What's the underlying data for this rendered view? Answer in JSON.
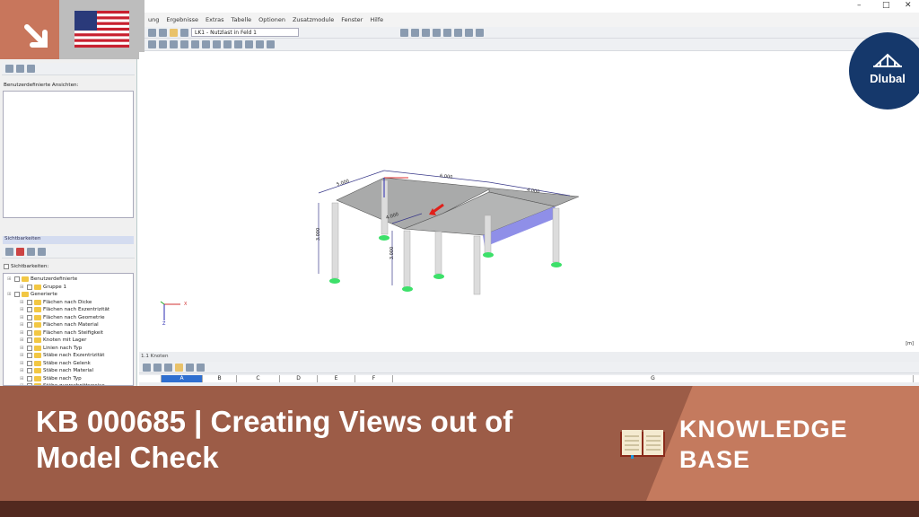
{
  "menu": [
    "ung",
    "Ergebnisse",
    "Extras",
    "Tabelle",
    "Optionen",
    "Zusatzmodule",
    "Fenster",
    "Hilfe"
  ],
  "loadcase": "LK1 - Nutzlast in Feld 1",
  "window_controls": {
    "minimize": "–",
    "maximize": "□",
    "close": "✕"
  },
  "left": {
    "custom_views_label": "Benutzerdefinierte Ansichten:",
    "visibility_header": "Sichtbarkeiten",
    "visibility_checkbox": "Sichtbarkeiten:",
    "tree": [
      {
        "label": "Benutzerdefinierte",
        "level": 0
      },
      {
        "label": "Gruppe 1",
        "level": 1
      },
      {
        "label": "Generierte",
        "level": 0
      },
      {
        "label": "Flächen nach Dicke",
        "level": 1
      },
      {
        "label": "Flächen nach Exzentrizität",
        "level": 1
      },
      {
        "label": "Flächen nach Geometrie",
        "level": 1
      },
      {
        "label": "Flächen nach Material",
        "level": 1
      },
      {
        "label": "Flächen nach Steifigkeit",
        "level": 1
      },
      {
        "label": "Knoten mit Lager",
        "level": 1
      },
      {
        "label": "Linien nach Typ",
        "level": 1
      },
      {
        "label": "Stäbe nach Exzentrizität",
        "level": 1
      },
      {
        "label": "Stäbe nach Gelenk",
        "level": 1
      },
      {
        "label": "Stäbe nach Material",
        "level": 1
      },
      {
        "label": "Stäbe nach Typ",
        "level": 1
      },
      {
        "label": "Stäbe querschnittsweise",
        "level": 1
      }
    ]
  },
  "model": {
    "dims": [
      "5.000",
      "6.000",
      "4.000",
      "3.000",
      "4.000",
      "3.000"
    ],
    "axes": {
      "x": "X",
      "z": "Z"
    },
    "unit": "[m]"
  },
  "table": {
    "title": "1.1 Knoten",
    "columns": [
      "A",
      "B",
      "C",
      "D",
      "E",
      "F",
      "G"
    ]
  },
  "brand": {
    "logo": "Dlubal"
  },
  "banner": {
    "title": "KB 000685 | Creating Views out of Model Check",
    "label_line1": "KNOWLEDGE",
    "label_line2": "BASE"
  }
}
